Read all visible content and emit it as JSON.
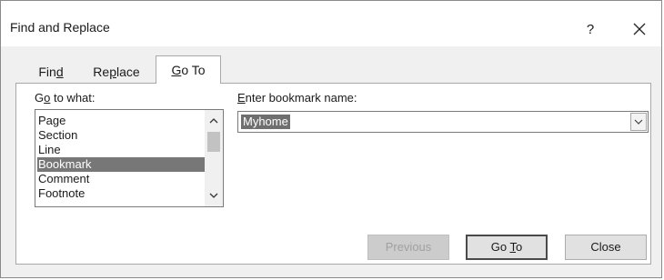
{
  "window": {
    "title": "Find and Replace",
    "help_label": "?"
  },
  "tabs": [
    {
      "pre": "Fin",
      "key": "d",
      "post": ""
    },
    {
      "pre": "Re",
      "key": "p",
      "post": "lace"
    },
    {
      "pre": "",
      "key": "G",
      "post": "o To"
    }
  ],
  "active_tab": "Go To",
  "goto_what": {
    "label_pre": "G",
    "label_key": "o",
    "label_post": " to what:",
    "items": [
      "Page",
      "Section",
      "Line",
      "Bookmark",
      "Comment",
      "Footnote"
    ],
    "selected": "Bookmark"
  },
  "bookmark": {
    "label_key": "E",
    "label_post": "nter bookmark name:",
    "value": "Myhome"
  },
  "buttons": {
    "previous": "Previous",
    "goto_pre": "Go ",
    "goto_key": "T",
    "goto_post": "o",
    "close": "Close"
  },
  "icons": {
    "help": "help",
    "close": "close-x",
    "scroll_up": "chevron-up",
    "scroll_down": "chevron-down",
    "dropdown": "chevron-down"
  }
}
